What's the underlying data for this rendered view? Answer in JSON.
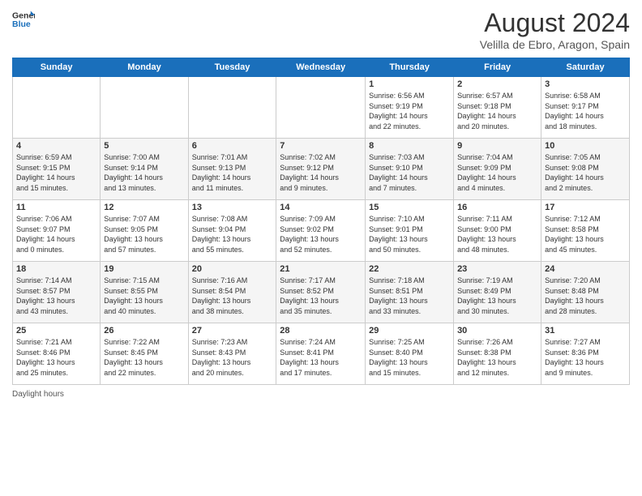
{
  "logo": {
    "line1": "General",
    "line2": "Blue"
  },
  "title": "August 2024",
  "subtitle": "Velilla de Ebro, Aragon, Spain",
  "days_of_week": [
    "Sunday",
    "Monday",
    "Tuesday",
    "Wednesday",
    "Thursday",
    "Friday",
    "Saturday"
  ],
  "weeks": [
    [
      {
        "day": "",
        "info": ""
      },
      {
        "day": "",
        "info": ""
      },
      {
        "day": "",
        "info": ""
      },
      {
        "day": "",
        "info": ""
      },
      {
        "day": "1",
        "info": "Sunrise: 6:56 AM\nSunset: 9:19 PM\nDaylight: 14 hours\nand 22 minutes."
      },
      {
        "day": "2",
        "info": "Sunrise: 6:57 AM\nSunset: 9:18 PM\nDaylight: 14 hours\nand 20 minutes."
      },
      {
        "day": "3",
        "info": "Sunrise: 6:58 AM\nSunset: 9:17 PM\nDaylight: 14 hours\nand 18 minutes."
      }
    ],
    [
      {
        "day": "4",
        "info": "Sunrise: 6:59 AM\nSunset: 9:15 PM\nDaylight: 14 hours\nand 15 minutes."
      },
      {
        "day": "5",
        "info": "Sunrise: 7:00 AM\nSunset: 9:14 PM\nDaylight: 14 hours\nand 13 minutes."
      },
      {
        "day": "6",
        "info": "Sunrise: 7:01 AM\nSunset: 9:13 PM\nDaylight: 14 hours\nand 11 minutes."
      },
      {
        "day": "7",
        "info": "Sunrise: 7:02 AM\nSunset: 9:12 PM\nDaylight: 14 hours\nand 9 minutes."
      },
      {
        "day": "8",
        "info": "Sunrise: 7:03 AM\nSunset: 9:10 PM\nDaylight: 14 hours\nand 7 minutes."
      },
      {
        "day": "9",
        "info": "Sunrise: 7:04 AM\nSunset: 9:09 PM\nDaylight: 14 hours\nand 4 minutes."
      },
      {
        "day": "10",
        "info": "Sunrise: 7:05 AM\nSunset: 9:08 PM\nDaylight: 14 hours\nand 2 minutes."
      }
    ],
    [
      {
        "day": "11",
        "info": "Sunrise: 7:06 AM\nSunset: 9:07 PM\nDaylight: 14 hours\nand 0 minutes."
      },
      {
        "day": "12",
        "info": "Sunrise: 7:07 AM\nSunset: 9:05 PM\nDaylight: 13 hours\nand 57 minutes."
      },
      {
        "day": "13",
        "info": "Sunrise: 7:08 AM\nSunset: 9:04 PM\nDaylight: 13 hours\nand 55 minutes."
      },
      {
        "day": "14",
        "info": "Sunrise: 7:09 AM\nSunset: 9:02 PM\nDaylight: 13 hours\nand 52 minutes."
      },
      {
        "day": "15",
        "info": "Sunrise: 7:10 AM\nSunset: 9:01 PM\nDaylight: 13 hours\nand 50 minutes."
      },
      {
        "day": "16",
        "info": "Sunrise: 7:11 AM\nSunset: 9:00 PM\nDaylight: 13 hours\nand 48 minutes."
      },
      {
        "day": "17",
        "info": "Sunrise: 7:12 AM\nSunset: 8:58 PM\nDaylight: 13 hours\nand 45 minutes."
      }
    ],
    [
      {
        "day": "18",
        "info": "Sunrise: 7:14 AM\nSunset: 8:57 PM\nDaylight: 13 hours\nand 43 minutes."
      },
      {
        "day": "19",
        "info": "Sunrise: 7:15 AM\nSunset: 8:55 PM\nDaylight: 13 hours\nand 40 minutes."
      },
      {
        "day": "20",
        "info": "Sunrise: 7:16 AM\nSunset: 8:54 PM\nDaylight: 13 hours\nand 38 minutes."
      },
      {
        "day": "21",
        "info": "Sunrise: 7:17 AM\nSunset: 8:52 PM\nDaylight: 13 hours\nand 35 minutes."
      },
      {
        "day": "22",
        "info": "Sunrise: 7:18 AM\nSunset: 8:51 PM\nDaylight: 13 hours\nand 33 minutes."
      },
      {
        "day": "23",
        "info": "Sunrise: 7:19 AM\nSunset: 8:49 PM\nDaylight: 13 hours\nand 30 minutes."
      },
      {
        "day": "24",
        "info": "Sunrise: 7:20 AM\nSunset: 8:48 PM\nDaylight: 13 hours\nand 28 minutes."
      }
    ],
    [
      {
        "day": "25",
        "info": "Sunrise: 7:21 AM\nSunset: 8:46 PM\nDaylight: 13 hours\nand 25 minutes."
      },
      {
        "day": "26",
        "info": "Sunrise: 7:22 AM\nSunset: 8:45 PM\nDaylight: 13 hours\nand 22 minutes."
      },
      {
        "day": "27",
        "info": "Sunrise: 7:23 AM\nSunset: 8:43 PM\nDaylight: 13 hours\nand 20 minutes."
      },
      {
        "day": "28",
        "info": "Sunrise: 7:24 AM\nSunset: 8:41 PM\nDaylight: 13 hours\nand 17 minutes."
      },
      {
        "day": "29",
        "info": "Sunrise: 7:25 AM\nSunset: 8:40 PM\nDaylight: 13 hours\nand 15 minutes."
      },
      {
        "day": "30",
        "info": "Sunrise: 7:26 AM\nSunset: 8:38 PM\nDaylight: 13 hours\nand 12 minutes."
      },
      {
        "day": "31",
        "info": "Sunrise: 7:27 AM\nSunset: 8:36 PM\nDaylight: 13 hours\nand 9 minutes."
      }
    ]
  ],
  "footer": "Daylight hours"
}
